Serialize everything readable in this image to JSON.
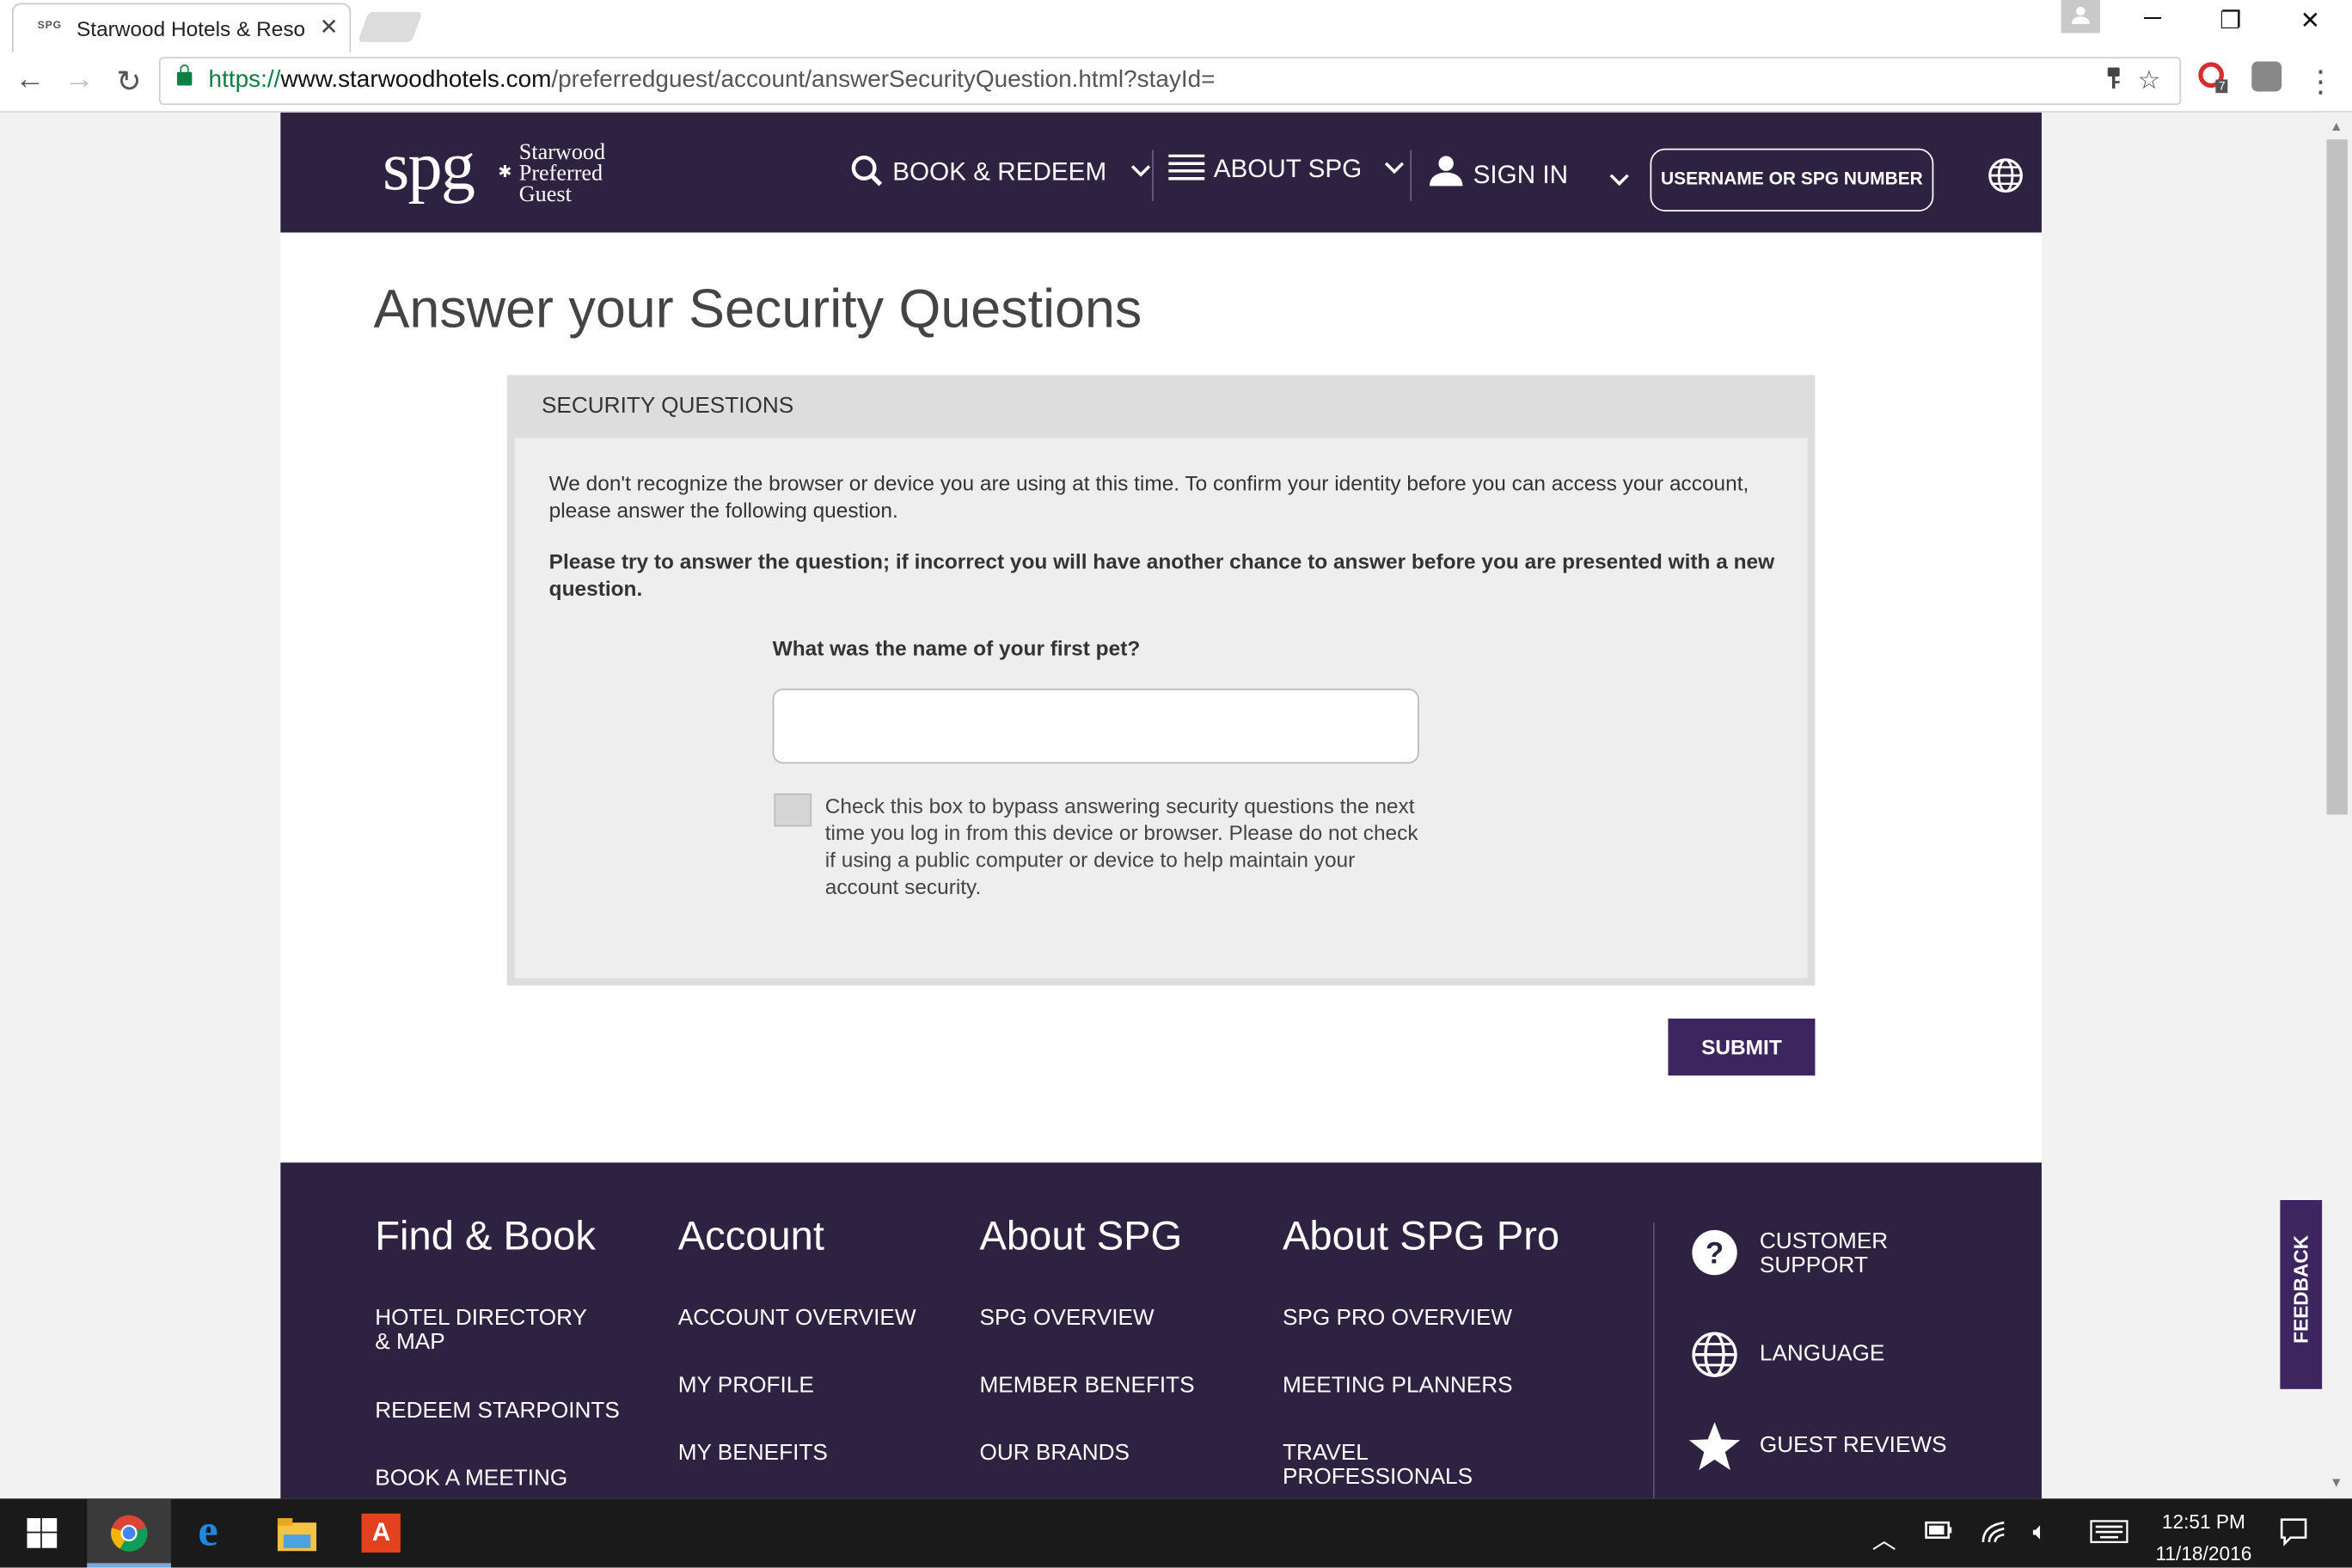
{
  "browser": {
    "tab_title": "Starwood Hotels & Resor",
    "tab_favicon": "SPG",
    "url_scheme": "https://",
    "url_host": "www.starwoodhotels.com",
    "url_path": "/preferredguest/account/answerSecurityQuestion.html?stayId=",
    "extension_badge": "7"
  },
  "header": {
    "logo": "spg",
    "logo_words": [
      "Starwood",
      "Preferred",
      "Guest"
    ],
    "nav": {
      "book": "BOOK & REDEEM",
      "about": "ABOUT SPG",
      "signin": "SIGN IN"
    },
    "username_button": "USERNAME OR SPG NUMBER"
  },
  "main": {
    "title": "Answer your Security Questions",
    "panel_title": "SECURITY QUESTIONS",
    "intro": "We don't recognize the browser or device you are using at this time. To confirm your identity before you can access your account, please answer the following question.",
    "instruction": "Please try to answer the question; if incorrect you will have another chance to answer before you are presented with a new question.",
    "question": "What was the name of your first pet?",
    "answer_value": "",
    "bypass_text": "Check this box to bypass answering security questions the next time you log in from this device or browser. Please do not check if using a public computer or device to help maintain your account security.",
    "bypass_checked": false,
    "submit": "SUBMIT"
  },
  "footer": {
    "columns": [
      {
        "heading": "Find & Book",
        "links": [
          "HOTEL DIRECTORY & MAP",
          "REDEEM STARPOINTS",
          "BOOK A MEETING"
        ]
      },
      {
        "heading": "Account",
        "links": [
          "ACCOUNT OVERVIEW",
          "MY PROFILE",
          "MY BENEFITS"
        ]
      },
      {
        "heading": "About SPG",
        "links": [
          "SPG OVERVIEW",
          "MEMBER BENEFITS",
          "OUR BRANDS"
        ]
      },
      {
        "heading": "About SPG Pro",
        "links": [
          "SPG PRO OVERVIEW",
          "MEETING PLANNERS",
          "TRAVEL PROFESSIONALS"
        ]
      }
    ],
    "side": {
      "support": "CUSTOMER SUPPORT",
      "language": "LANGUAGE",
      "reviews": "GUEST REVIEWS"
    },
    "feedback": "FEEDBACK"
  },
  "taskbar": {
    "time": "12:51 PM",
    "date": "11/18/2016"
  },
  "colors": {
    "brand_purple": "#2d2341",
    "button_purple": "#3d2660"
  }
}
